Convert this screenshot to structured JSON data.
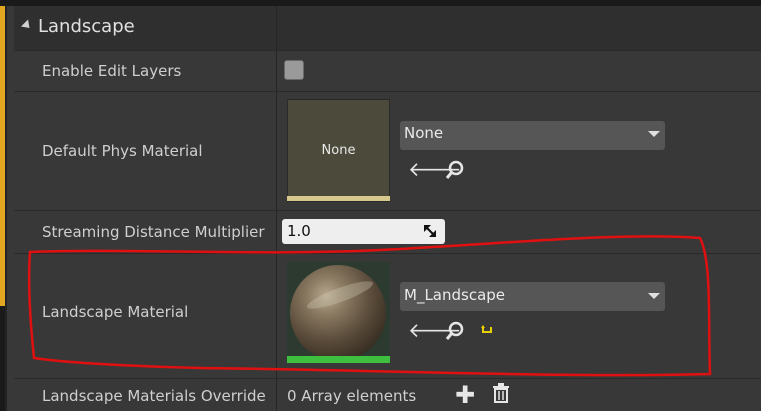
{
  "category": {
    "title": "Landscape"
  },
  "rows": {
    "enable_edit_layers": {
      "label": "Enable Edit Layers"
    },
    "default_phys_material": {
      "label": "Default Phys Material",
      "thumbnail_text": "None",
      "selected": "None"
    },
    "streaming_distance": {
      "label": "Streaming Distance Multiplier",
      "value": "1.0"
    },
    "landscape_material": {
      "label": "Landscape Material",
      "selected": "M_Landscape"
    },
    "materials_override": {
      "label": "Landscape Materials Override",
      "value": "0 Array elements"
    }
  },
  "colors": {
    "accent": "#e3a621",
    "annotation": "#e01010"
  }
}
